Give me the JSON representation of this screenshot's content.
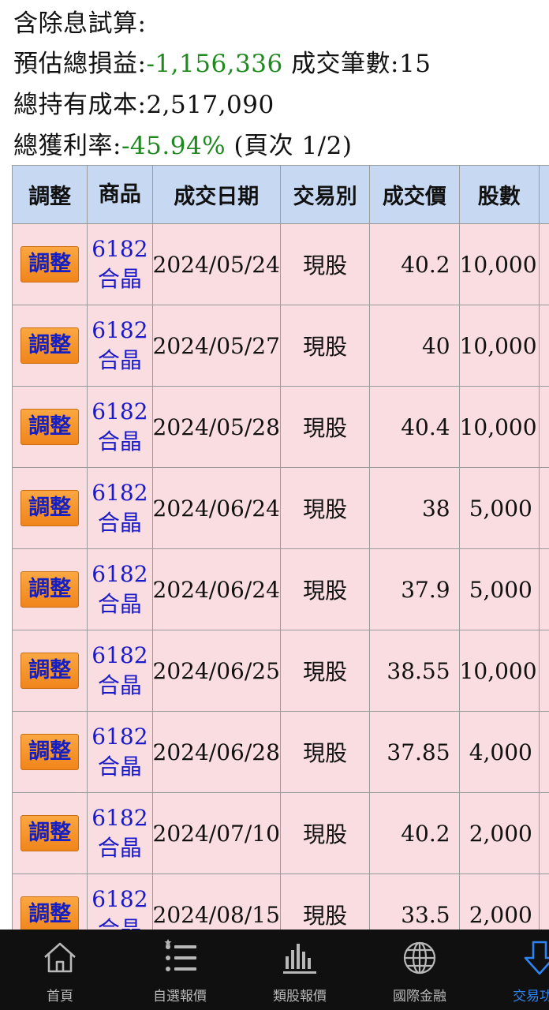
{
  "summary": {
    "title": "含除息試算:",
    "est_pl_label": "預估總損益:",
    "est_pl_value": "-1,156,336",
    "trade_count_label": "成交筆數:",
    "trade_count_value": "15",
    "cost_label": "總持有成本:",
    "cost_value": "2,517,090",
    "profit_rate_label": "總獲利率:",
    "profit_rate_value": "-45.94%",
    "page_info": "(頁次 1/2)"
  },
  "table": {
    "headers": [
      "調整",
      "商品",
      "成交日期",
      "交易別",
      "成交價",
      "股數"
    ],
    "rows": [
      {
        "adjust": "調整",
        "code": "6182",
        "name": "合晶",
        "date": "2024/05/24",
        "type": "現股",
        "price": "40.2",
        "qty": "10,000"
      },
      {
        "adjust": "調整",
        "code": "6182",
        "name": "合晶",
        "date": "2024/05/27",
        "type": "現股",
        "price": "40",
        "qty": "10,000"
      },
      {
        "adjust": "調整",
        "code": "6182",
        "name": "合晶",
        "date": "2024/05/28",
        "type": "現股",
        "price": "40.4",
        "qty": "10,000"
      },
      {
        "adjust": "調整",
        "code": "6182",
        "name": "合晶",
        "date": "2024/06/24",
        "type": "現股",
        "price": "38",
        "qty": "5,000"
      },
      {
        "adjust": "調整",
        "code": "6182",
        "name": "合晶",
        "date": "2024/06/24",
        "type": "現股",
        "price": "37.9",
        "qty": "5,000"
      },
      {
        "adjust": "調整",
        "code": "6182",
        "name": "合晶",
        "date": "2024/06/25",
        "type": "現股",
        "price": "38.55",
        "qty": "10,000"
      },
      {
        "adjust": "調整",
        "code": "6182",
        "name": "合晶",
        "date": "2024/06/28",
        "type": "現股",
        "price": "37.85",
        "qty": "4,000"
      },
      {
        "adjust": "調整",
        "code": "6182",
        "name": "合晶",
        "date": "2024/07/10",
        "type": "現股",
        "price": "40.2",
        "qty": "2,000"
      },
      {
        "adjust": "調整",
        "code": "6182",
        "name": "合晶",
        "date": "2024/08/15",
        "type": "現股",
        "price": "33.5",
        "qty": "2,000"
      }
    ]
  },
  "tabbar": {
    "accent_color": "#2c84f0",
    "tabs": [
      {
        "label": "首頁",
        "icon": "home-icon"
      },
      {
        "label": "自選報價",
        "icon": "list-icon"
      },
      {
        "label": "類股報價",
        "icon": "bar-chart-icon"
      },
      {
        "label": "國際金融",
        "icon": "globe-icon"
      },
      {
        "label": "交易功能",
        "icon": "arrow-down-icon",
        "active": true
      }
    ]
  }
}
